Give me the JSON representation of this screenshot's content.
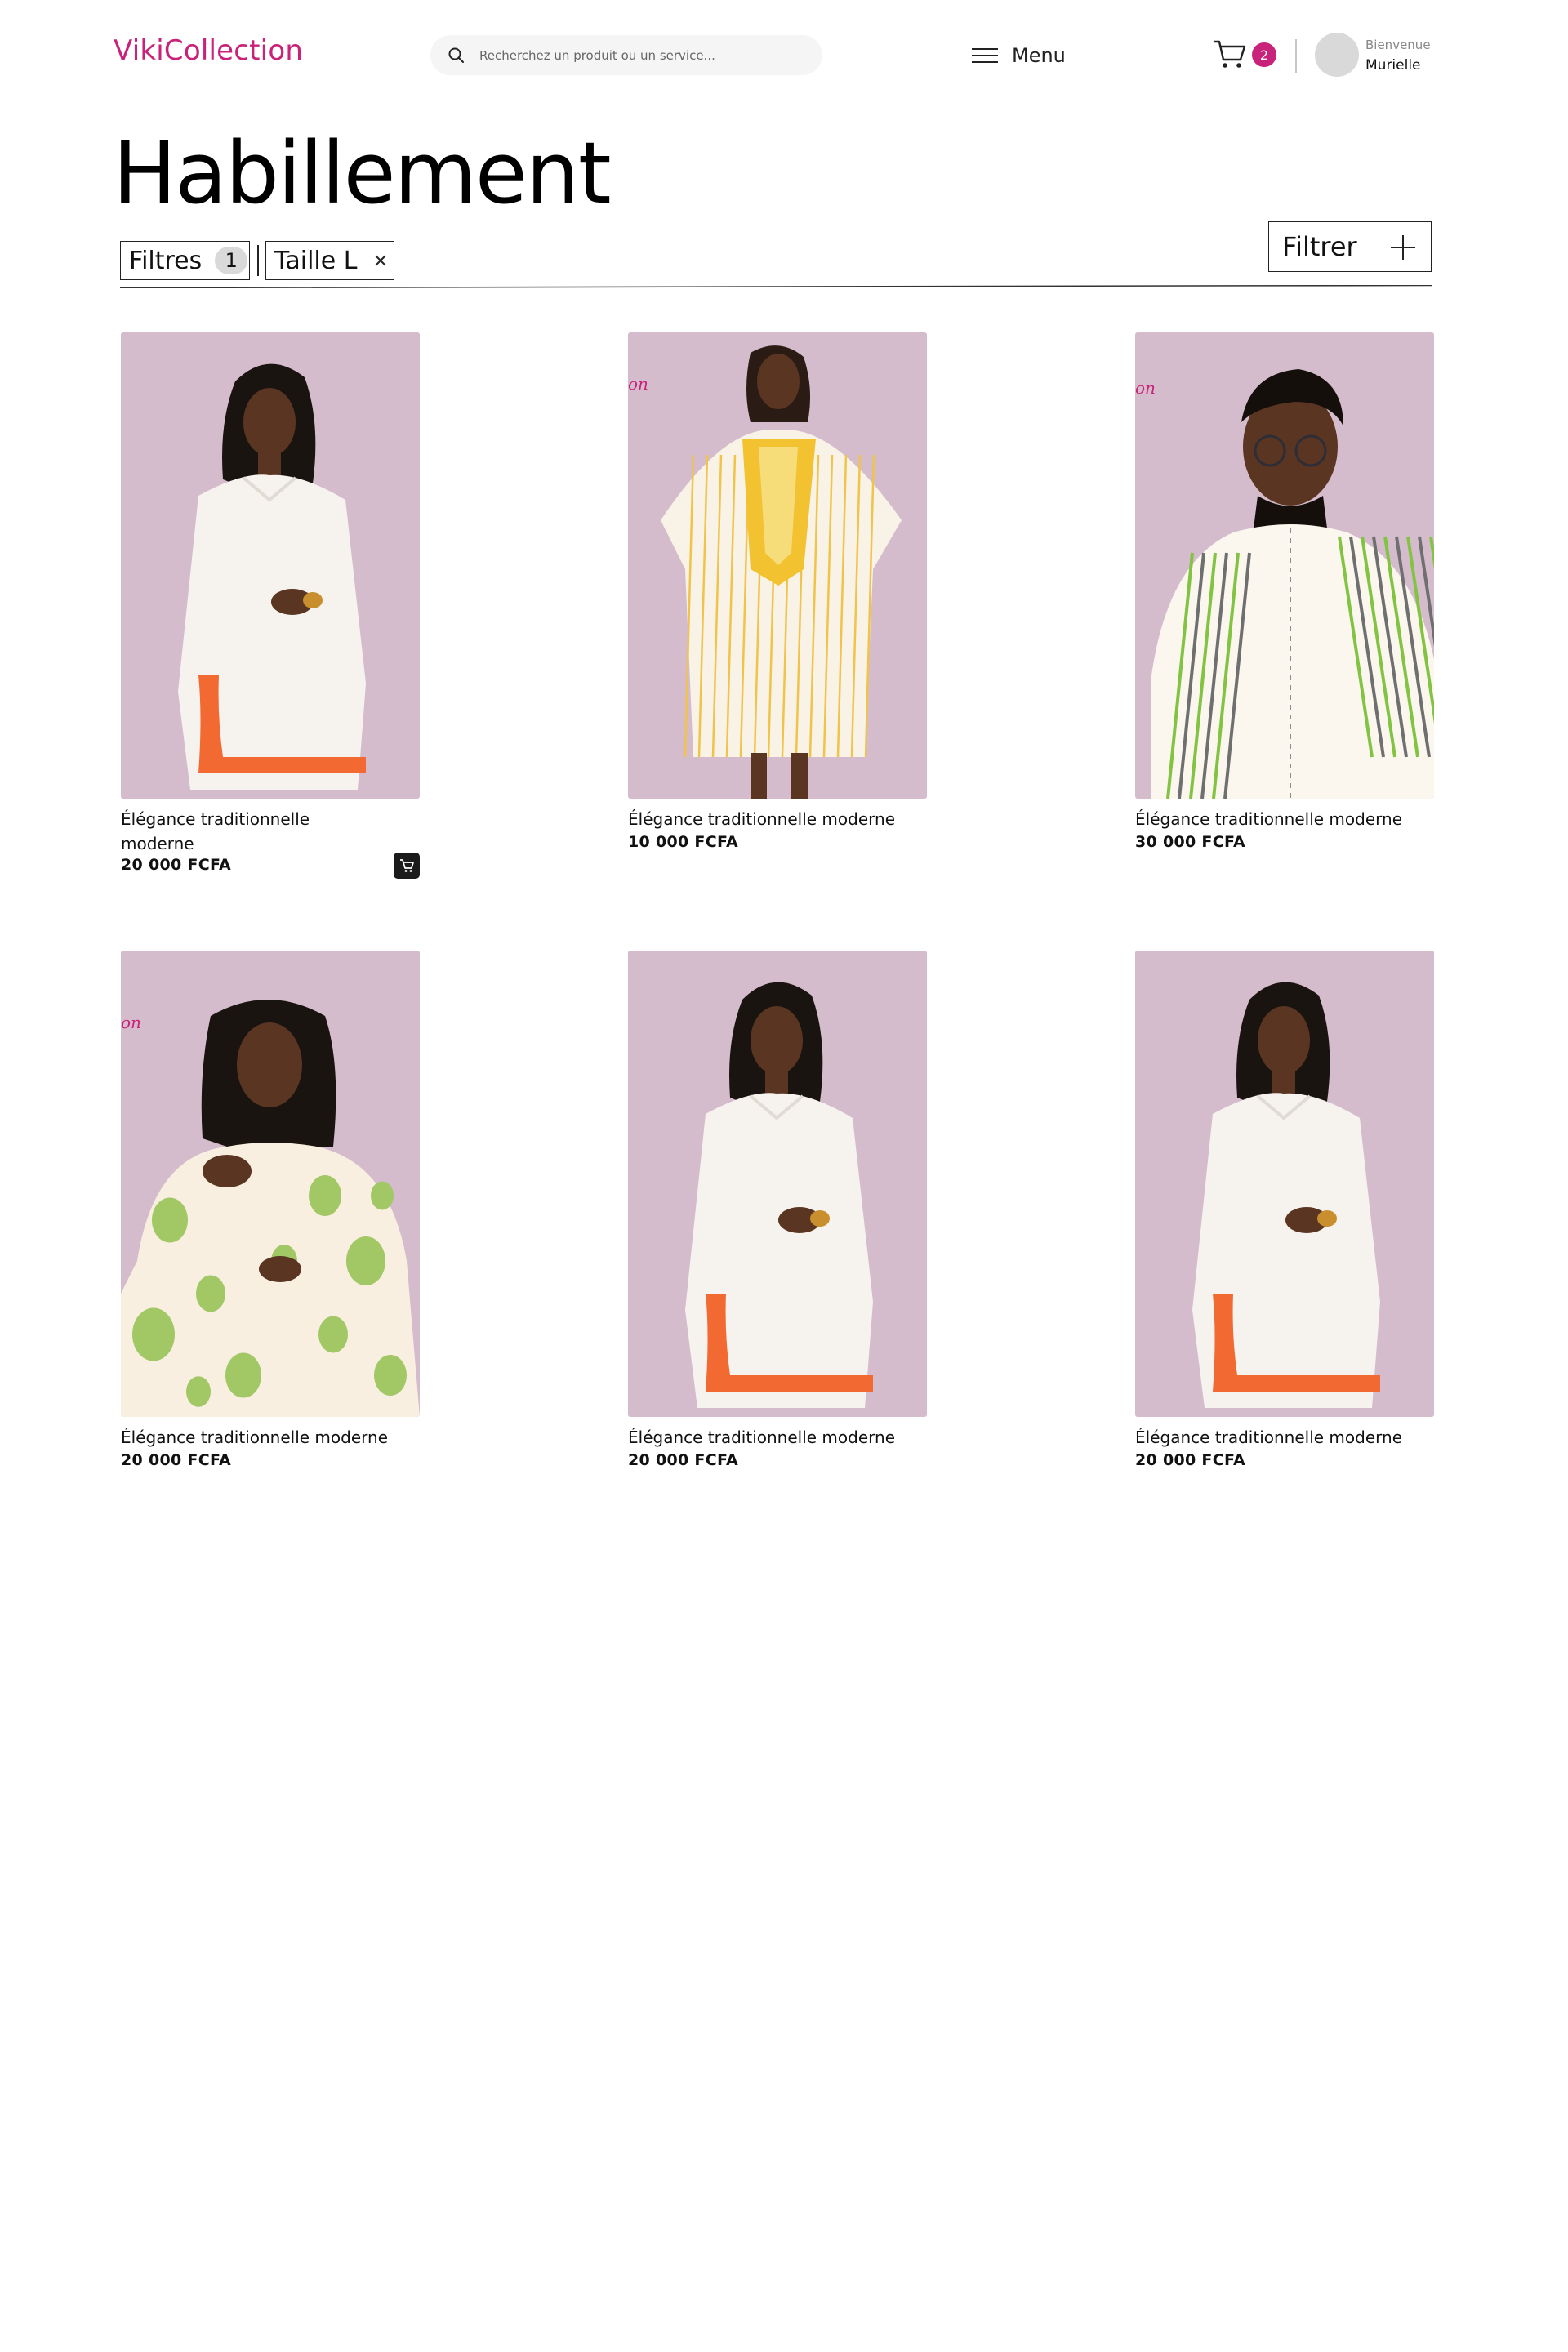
{
  "header": {
    "brand": "VikiCollection",
    "search_placeholder": "Recherchez un produit ou un service...",
    "menu_label": "Menu",
    "cart_count": "2",
    "welcome": "Bienvenue",
    "user_name": "Murielle"
  },
  "page": {
    "title": "Habillement"
  },
  "filters": {
    "label": "Filtres",
    "count": "1",
    "active_filter": "Taille L",
    "filter_button": "Filtrer"
  },
  "colors": {
    "brand": "#c8227a",
    "backdrop": "#d9c3d2",
    "ink": "#111111"
  },
  "products": [
    {
      "name": "Élégance traditionnelle moderne",
      "price": "20 000 FCFA",
      "style": "white-orange"
    },
    {
      "name": "Élégance traditionnelle moderne",
      "price": "10 000 FCFA",
      "style": "yellow-boubou"
    },
    {
      "name": "Élégance traditionnelle moderne",
      "price": "30 000 FCFA",
      "style": "green-stripe-man"
    },
    {
      "name": "Élégance traditionnelle moderne",
      "price": "20 000 FCFA",
      "style": "green-dots"
    },
    {
      "name": "Élégance traditionnelle moderne",
      "price": "20 000 FCFA",
      "style": "white-orange"
    },
    {
      "name": "Élégance traditionnelle moderne",
      "price": "20 000 FCFA",
      "style": "white-orange"
    }
  ]
}
